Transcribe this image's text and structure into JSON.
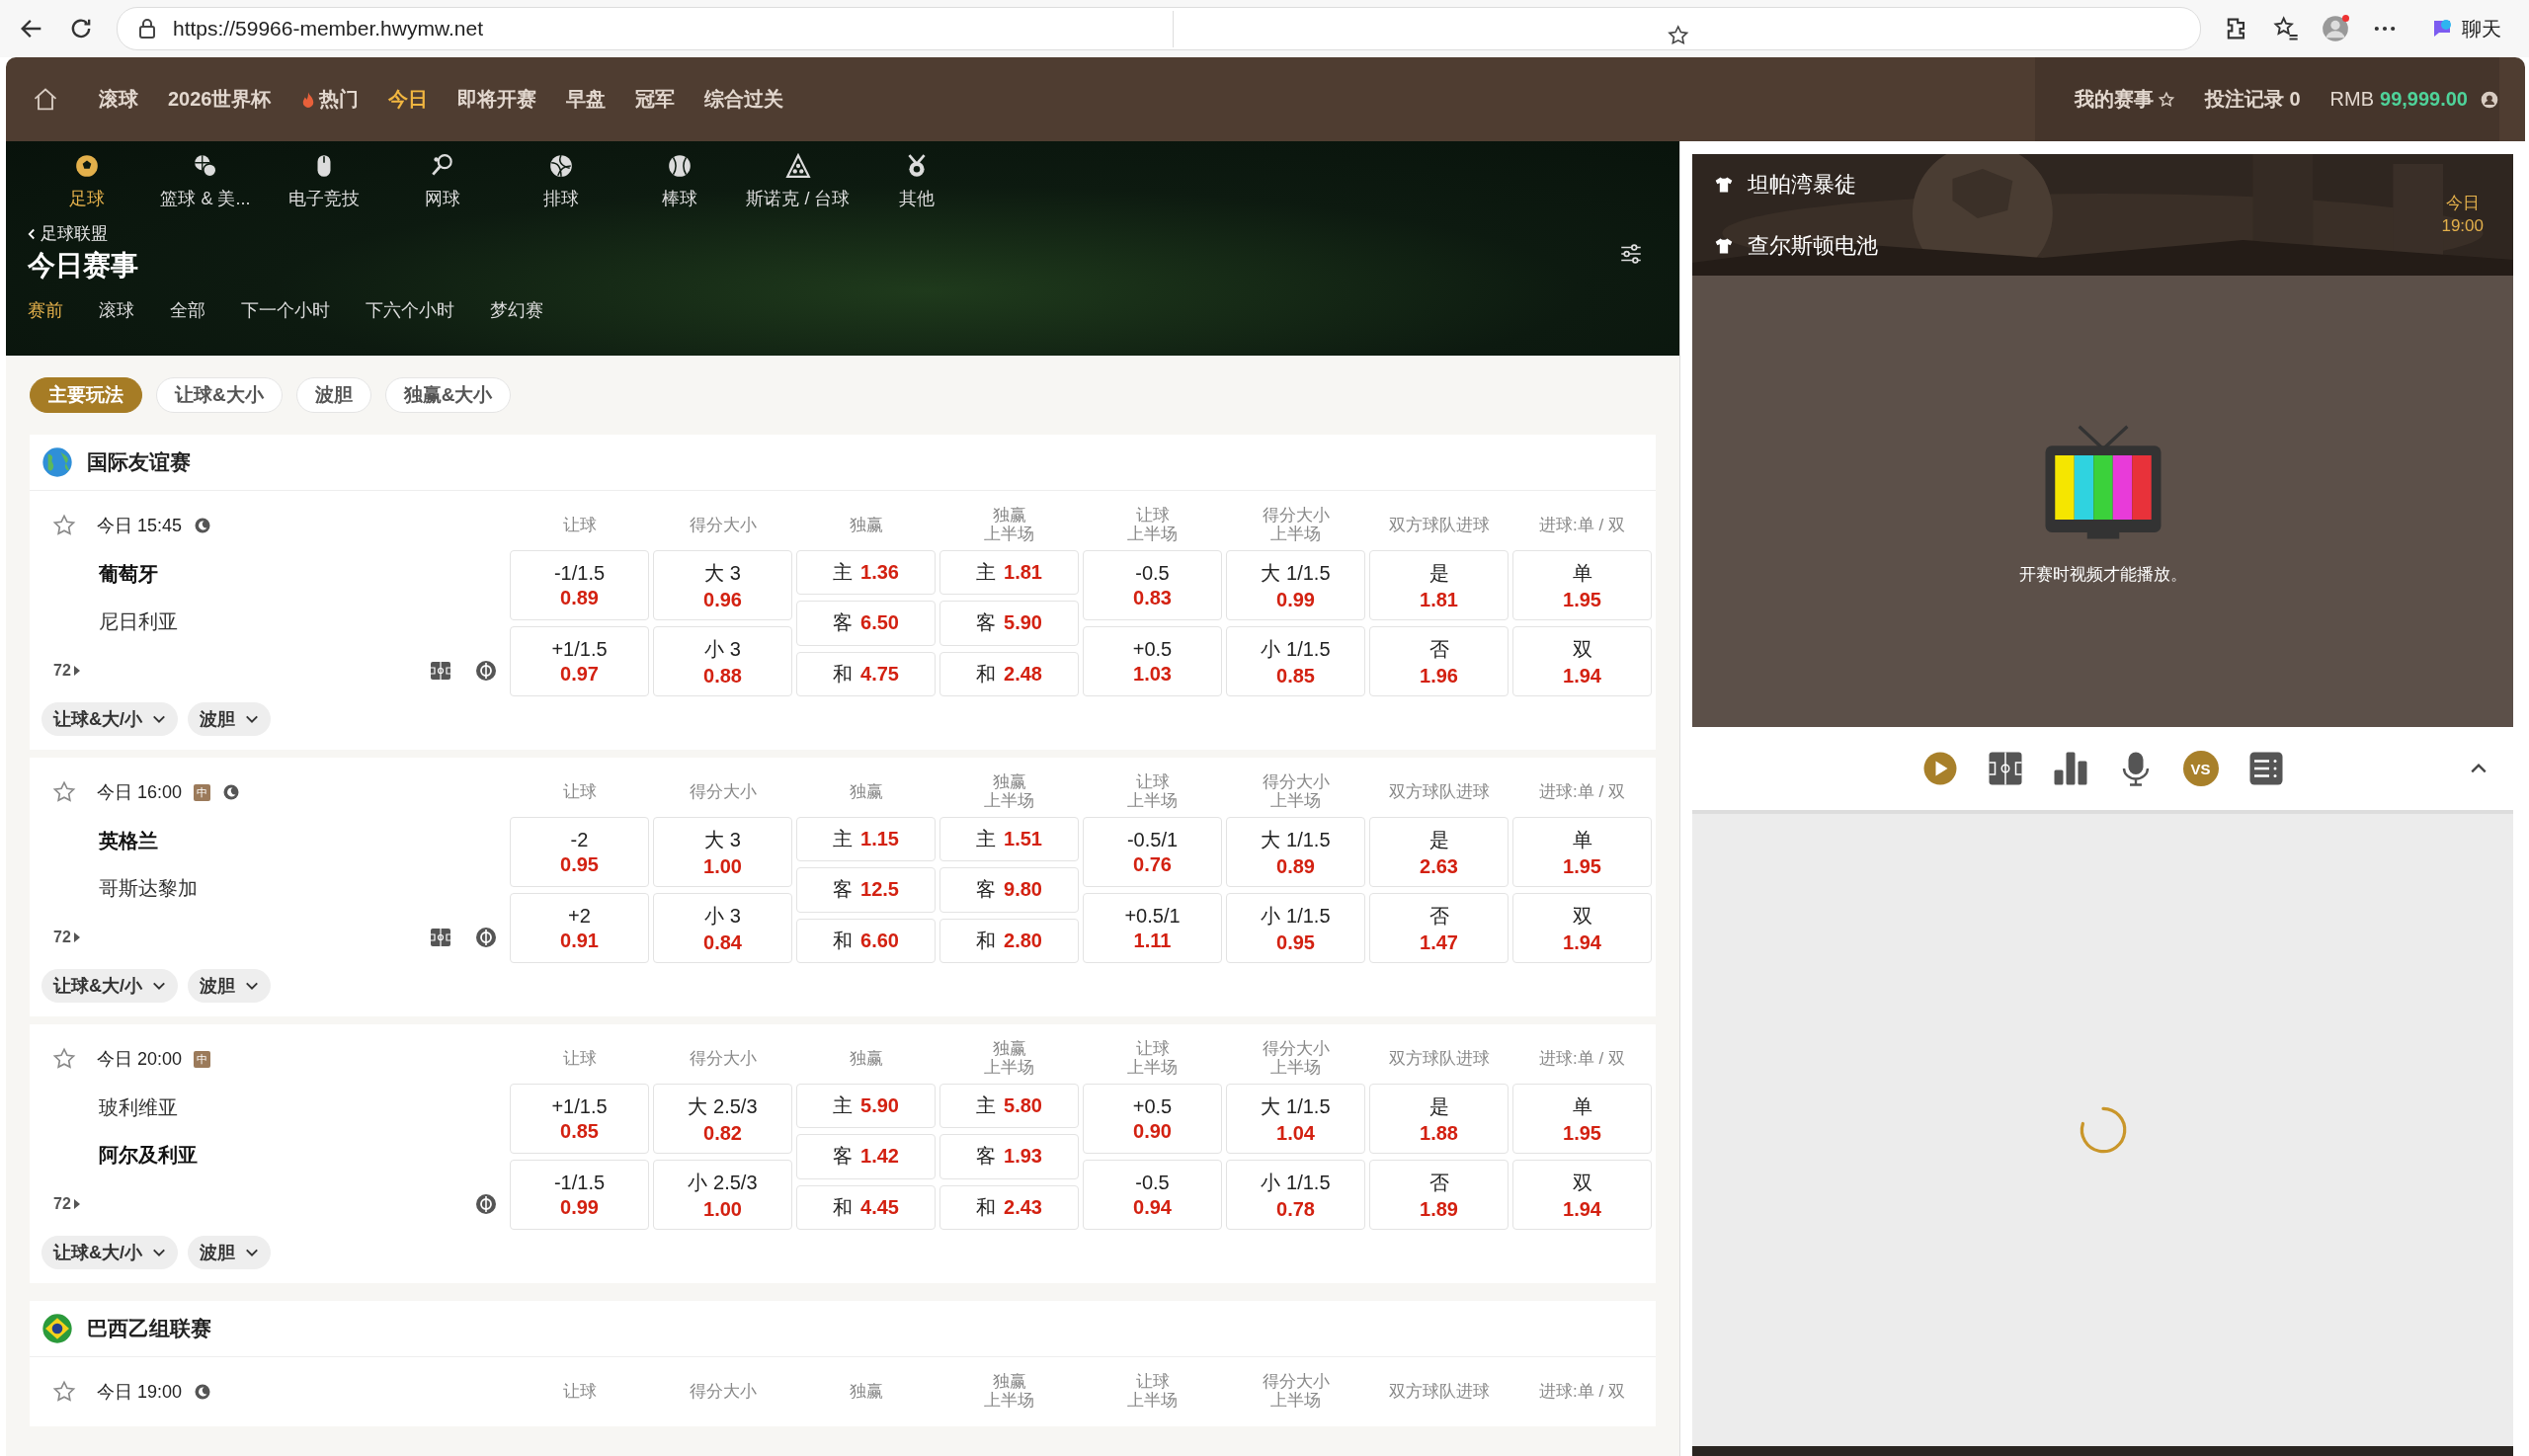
{
  "browser": {
    "url": "https://59966-member.hwymw.net",
    "chat": "聊天"
  },
  "nav": {
    "items": [
      {
        "label": "滚球",
        "selected": false,
        "hot": false
      },
      {
        "label": "2026世界杯",
        "selected": false,
        "hot": false
      },
      {
        "label": "热门",
        "selected": false,
        "hot": true
      },
      {
        "label": "今日",
        "selected": true,
        "hot": false
      },
      {
        "label": "即将开赛",
        "selected": false,
        "hot": false
      },
      {
        "label": "早盘",
        "selected": false,
        "hot": false
      },
      {
        "label": "冠军",
        "selected": false,
        "hot": false
      },
      {
        "label": "综合过关",
        "selected": false,
        "hot": false
      }
    ],
    "my_events": "我的赛事",
    "bet_record": "投注记录 0",
    "currency": "RMB",
    "balance": "99,999.00"
  },
  "sports": [
    {
      "label": "足球",
      "kind": "soccer",
      "selected": true
    },
    {
      "label": "篮球 & 美...",
      "kind": "basketball",
      "selected": false
    },
    {
      "label": "电子竞技",
      "kind": "esports",
      "selected": false
    },
    {
      "label": "网球",
      "kind": "tennis",
      "selected": false
    },
    {
      "label": "排球",
      "kind": "volleyball",
      "selected": false
    },
    {
      "label": "棒球",
      "kind": "baseball",
      "selected": false
    },
    {
      "label": "斯诺克 / 台球",
      "kind": "snooker",
      "selected": false
    },
    {
      "label": "其他",
      "kind": "other",
      "selected": false
    }
  ],
  "breadcrumb": "足球联盟",
  "page_title": "今日赛事",
  "time_tabs": [
    {
      "label": "赛前",
      "selected": true
    },
    {
      "label": "滚球",
      "selected": false
    },
    {
      "label": "全部",
      "selected": false
    },
    {
      "label": "下一个小时",
      "selected": false
    },
    {
      "label": "下六个小时",
      "selected": false
    },
    {
      "label": "梦幻赛",
      "selected": false
    }
  ],
  "market_tabs": [
    {
      "label": "主要玩法",
      "selected": true
    },
    {
      "label": "让球&大小",
      "selected": false
    },
    {
      "label": "波胆",
      "selected": false
    },
    {
      "label": "独赢&大小",
      "selected": false
    }
  ],
  "leagues": [
    {
      "name": "国际友谊赛",
      "kind": "globe",
      "matches": [
        {
          "time": "今日 15:45",
          "moon": true,
          "more": "72",
          "field_icon": true,
          "teams": [
            {
              "name": "葡萄牙",
              "strong": true
            },
            {
              "name": "尼日利亚",
              "strong": false
            }
          ],
          "columns": [
            [
              "让球"
            ],
            [
              "得分大小"
            ],
            [
              "独赢"
            ],
            [
              "独赢",
              "上半场"
            ],
            [
              "让球",
              "上半场"
            ],
            [
              "得分大小",
              "上半场"
            ],
            [
              "双方球队进球"
            ],
            [
              "进球:单 / 双"
            ]
          ],
          "markets": [
            {
              "kind": "line",
              "cells": [
                {
                  "label": "-1/1.5",
                  "odds": "0.89"
                },
                {
                  "label": "+1/1.5",
                  "odds": "0.97"
                }
              ]
            },
            {
              "kind": "line",
              "cells": [
                {
                  "label": "大 3",
                  "odds": "0.96"
                },
                {
                  "label": "小 3",
                  "odds": "0.88"
                }
              ]
            },
            {
              "kind": "three_way",
              "cells": [
                {
                  "label": "主",
                  "odds": "1.36"
                },
                {
                  "label": "客",
                  "odds": "6.50"
                },
                {
                  "label": "和",
                  "odds": "4.75"
                }
              ]
            },
            {
              "kind": "three_way",
              "cells": [
                {
                  "label": "主",
                  "odds": "1.81"
                },
                {
                  "label": "客",
                  "odds": "5.90"
                },
                {
                  "label": "和",
                  "odds": "2.48"
                }
              ]
            },
            {
              "kind": "line",
              "cells": [
                {
                  "label": "-0.5",
                  "odds": "0.83"
                },
                {
                  "label": "+0.5",
                  "odds": "1.03"
                }
              ]
            },
            {
              "kind": "line",
              "cells": [
                {
                  "label": "大 1/1.5",
                  "odds": "0.99"
                },
                {
                  "label": "小 1/1.5",
                  "odds": "0.85"
                }
              ]
            },
            {
              "kind": "line",
              "cells": [
                {
                  "label": "是",
                  "odds": "1.81"
                },
                {
                  "label": "否",
                  "odds": "1.96"
                }
              ]
            },
            {
              "kind": "line",
              "cells": [
                {
                  "label": "单",
                  "odds": "1.95"
                },
                {
                  "label": "双",
                  "odds": "1.94"
                }
              ]
            }
          ],
          "dropdowns": [
            "让球&大/小",
            "波胆"
          ]
        },
        {
          "time": "今日 16:00",
          "badge": "中",
          "moon": true,
          "more": "72",
          "field_icon": true,
          "teams": [
            {
              "name": "英格兰",
              "strong": true
            },
            {
              "name": "哥斯达黎加",
              "strong": false
            }
          ],
          "columns": [
            [
              "让球"
            ],
            [
              "得分大小"
            ],
            [
              "独赢"
            ],
            [
              "独赢",
              "上半场"
            ],
            [
              "让球",
              "上半场"
            ],
            [
              "得分大小",
              "上半场"
            ],
            [
              "双方球队进球"
            ],
            [
              "进球:单 / 双"
            ]
          ],
          "markets": [
            {
              "kind": "line",
              "cells": [
                {
                  "label": "-2",
                  "odds": "0.95"
                },
                {
                  "label": "+2",
                  "odds": "0.91"
                }
              ]
            },
            {
              "kind": "line",
              "cells": [
                {
                  "label": "大 3",
                  "odds": "1.00"
                },
                {
                  "label": "小 3",
                  "odds": "0.84"
                }
              ]
            },
            {
              "kind": "three_way",
              "cells": [
                {
                  "label": "主",
                  "odds": "1.15"
                },
                {
                  "label": "客",
                  "odds": "12.5"
                },
                {
                  "label": "和",
                  "odds": "6.60"
                }
              ]
            },
            {
              "kind": "three_way",
              "cells": [
                {
                  "label": "主",
                  "odds": "1.51"
                },
                {
                  "label": "客",
                  "odds": "9.80"
                },
                {
                  "label": "和",
                  "odds": "2.80"
                }
              ]
            },
            {
              "kind": "line",
              "cells": [
                {
                  "label": "-0.5/1",
                  "odds": "0.76"
                },
                {
                  "label": "+0.5/1",
                  "odds": "1.11"
                }
              ]
            },
            {
              "kind": "line",
              "cells": [
                {
                  "label": "大 1/1.5",
                  "odds": "0.89"
                },
                {
                  "label": "小 1/1.5",
                  "odds": "0.95"
                }
              ]
            },
            {
              "kind": "line",
              "cells": [
                {
                  "label": "是",
                  "odds": "2.63"
                },
                {
                  "label": "否",
                  "odds": "1.47"
                }
              ]
            },
            {
              "kind": "line",
              "cells": [
                {
                  "label": "单",
                  "odds": "1.95"
                },
                {
                  "label": "双",
                  "odds": "1.94"
                }
              ]
            }
          ],
          "dropdowns": [
            "让球&大/小",
            "波胆"
          ]
        },
        {
          "time": "今日 20:00",
          "badge": "中",
          "moon": false,
          "more": "72",
          "field_icon": false,
          "teams": [
            {
              "name": "玻利维亚",
              "strong": false
            },
            {
              "name": "阿尔及利亚",
              "strong": true
            }
          ],
          "columns": [
            [
              "让球"
            ],
            [
              "得分大小"
            ],
            [
              "独赢"
            ],
            [
              "独赢",
              "上半场"
            ],
            [
              "让球",
              "上半场"
            ],
            [
              "得分大小",
              "上半场"
            ],
            [
              "双方球队进球"
            ],
            [
              "进球:单 / 双"
            ]
          ],
          "markets": [
            {
              "kind": "line",
              "cells": [
                {
                  "label": "+1/1.5",
                  "odds": "0.85"
                },
                {
                  "label": "-1/1.5",
                  "odds": "0.99"
                }
              ]
            },
            {
              "kind": "line",
              "cells": [
                {
                  "label": "大 2.5/3",
                  "odds": "0.82"
                },
                {
                  "label": "小 2.5/3",
                  "odds": "1.00"
                }
              ]
            },
            {
              "kind": "three_way",
              "cells": [
                {
                  "label": "主",
                  "odds": "5.90"
                },
                {
                  "label": "客",
                  "odds": "1.42"
                },
                {
                  "label": "和",
                  "odds": "4.45"
                }
              ]
            },
            {
              "kind": "three_way",
              "cells": [
                {
                  "label": "主",
                  "odds": "5.80"
                },
                {
                  "label": "客",
                  "odds": "1.93"
                },
                {
                  "label": "和",
                  "odds": "2.43"
                }
              ]
            },
            {
              "kind": "line",
              "cells": [
                {
                  "label": "+0.5",
                  "odds": "0.90"
                },
                {
                  "label": "-0.5",
                  "odds": "0.94"
                }
              ]
            },
            {
              "kind": "line",
              "cells": [
                {
                  "label": "大 1/1.5",
                  "odds": "1.04"
                },
                {
                  "label": "小 1/1.5",
                  "odds": "0.78"
                }
              ]
            },
            {
              "kind": "line",
              "cells": [
                {
                  "label": "是",
                  "odds": "1.88"
                },
                {
                  "label": "否",
                  "odds": "1.89"
                }
              ]
            },
            {
              "kind": "line",
              "cells": [
                {
                  "label": "单",
                  "odds": "1.95"
                },
                {
                  "label": "双",
                  "odds": "1.94"
                }
              ]
            }
          ],
          "dropdowns": [
            "让球&大/小",
            "波胆"
          ]
        }
      ]
    },
    {
      "name": "巴西乙组联赛",
      "kind": "brazil",
      "matches": [
        {
          "time": "今日 19:00",
          "moon": true,
          "columns": [
            [
              "让球"
            ],
            [
              "得分大小"
            ],
            [
              "独赢"
            ],
            [
              "独赢",
              "上半场"
            ],
            [
              "让球",
              "上半场"
            ],
            [
              "得分大小",
              "上半场"
            ],
            [
              "双方球队进球"
            ],
            [
              "进球:单 / 双"
            ]
          ]
        }
      ]
    }
  ],
  "video": {
    "home": "坦帕湾暴徒",
    "away": "查尔斯顿电池",
    "day": "今日",
    "time": "19:00",
    "notice": "开赛时视频才能播放。",
    "tools": [
      {
        "kind": "play"
      },
      {
        "kind": "field"
      },
      {
        "kind": "stats"
      },
      {
        "kind": "mic"
      },
      {
        "kind": "vs",
        "label": "VS"
      },
      {
        "kind": "list"
      }
    ]
  }
}
